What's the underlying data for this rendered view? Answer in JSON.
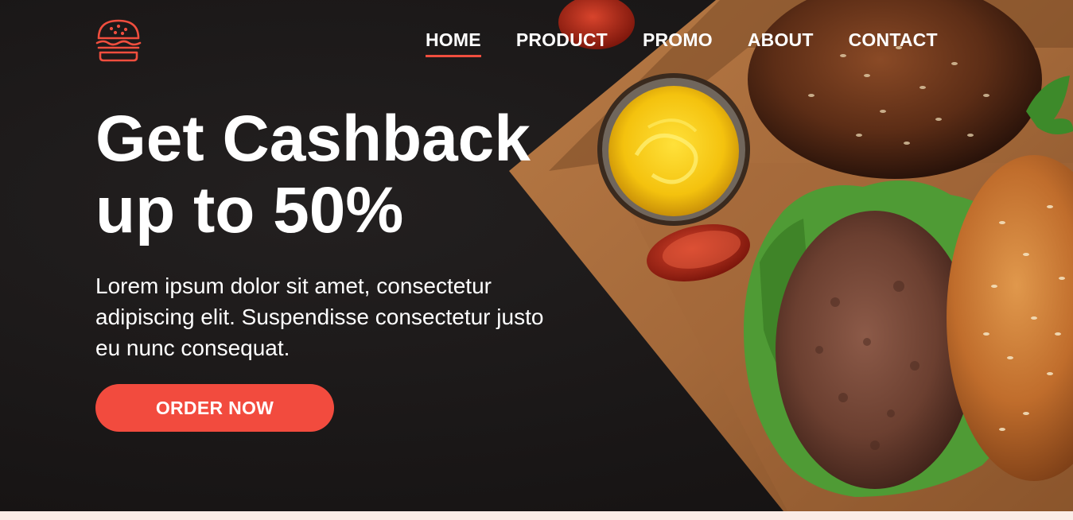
{
  "nav": {
    "items": [
      {
        "label": "HOME",
        "active": true
      },
      {
        "label": "PRODUCT",
        "active": false
      },
      {
        "label": "PROMO",
        "active": false
      },
      {
        "label": "ABOUT",
        "active": false
      },
      {
        "label": "CONTACT",
        "active": false
      }
    ]
  },
  "hero": {
    "headline_line1": "Get Cashback",
    "headline_line2": "up to 50%",
    "description": "Lorem ipsum dolor sit amet, consectetur adipiscing elit. Suspendisse consectetur justo eu nunc consequat.",
    "cta_label": "ORDER NOW"
  },
  "colors": {
    "accent": "#f24b3e",
    "background": "#181515",
    "text": "#ffffff",
    "bottom_strip": "#fbece6"
  },
  "icons": {
    "logo": "burger-icon"
  }
}
